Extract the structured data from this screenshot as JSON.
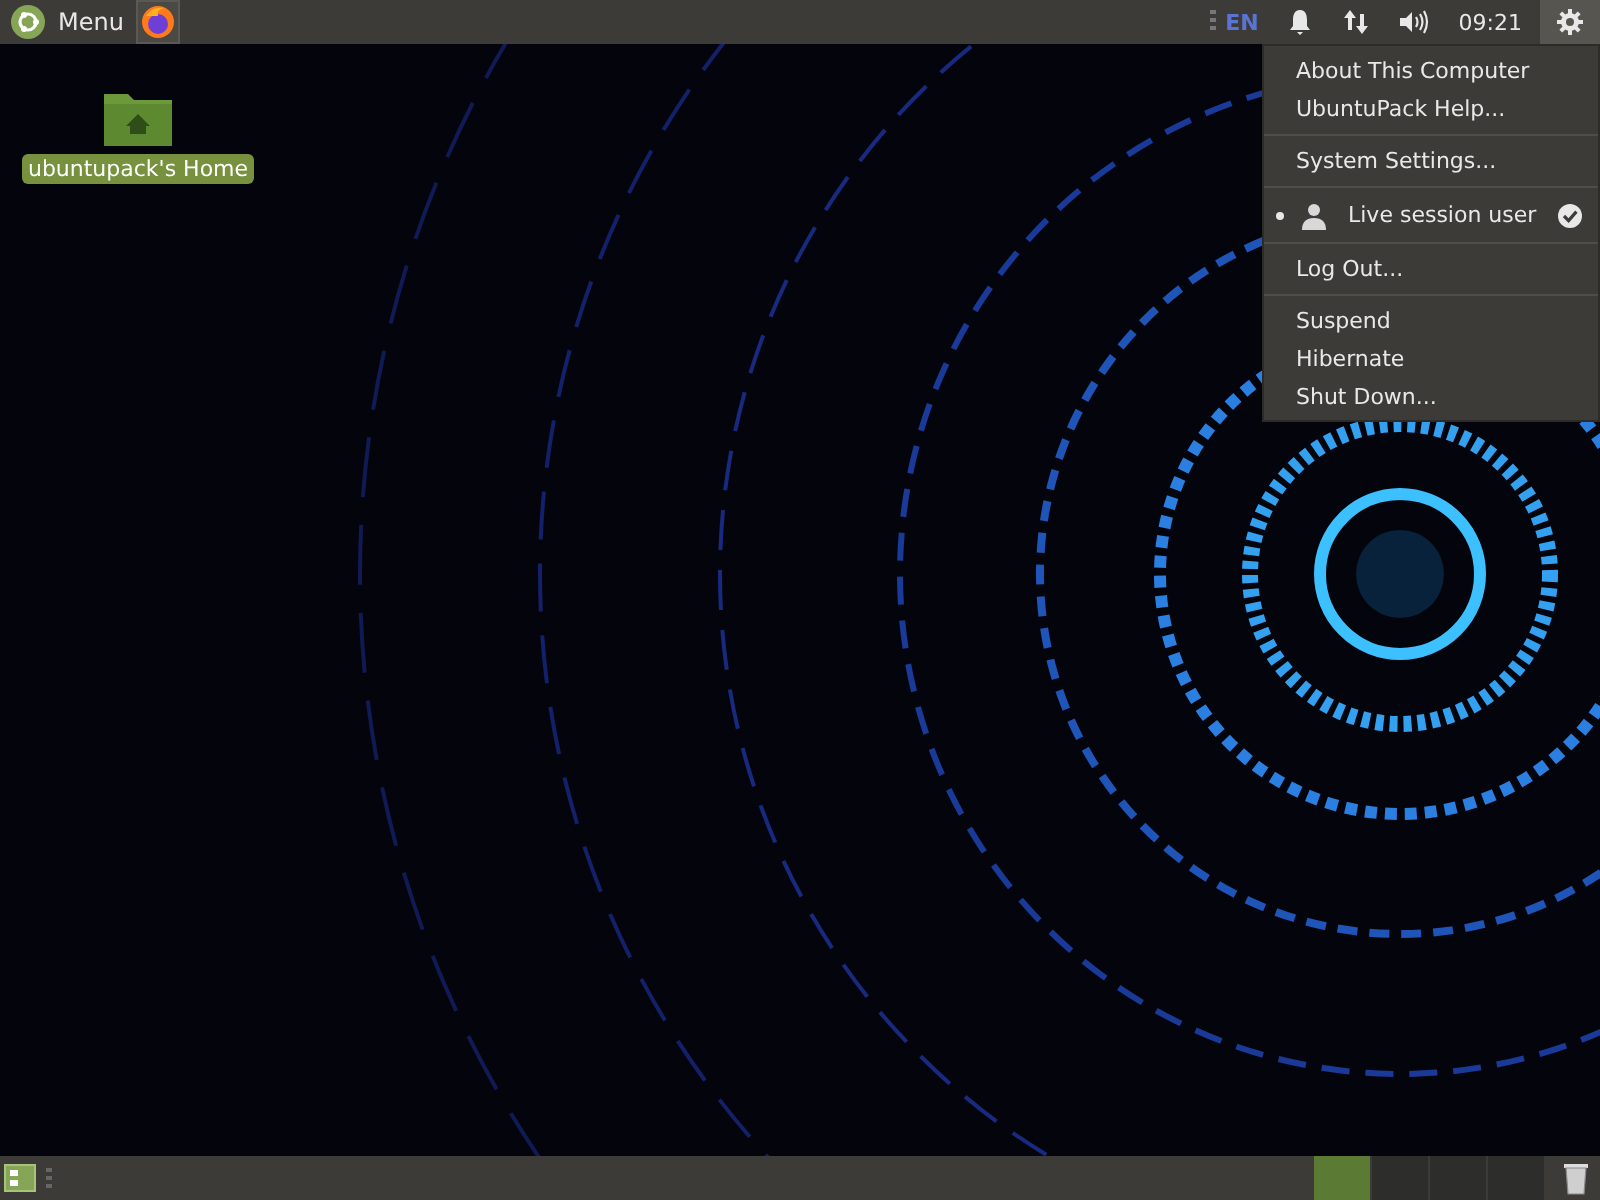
{
  "top_panel": {
    "menu_label": "Menu",
    "keyboard_layout": "EN",
    "clock": "09:21"
  },
  "desktop_icons": [
    {
      "label": "ubuntupack's Home"
    }
  ],
  "system_menu": {
    "items": [
      {
        "kind": "item",
        "label": "About This Computer"
      },
      {
        "kind": "item",
        "label": "UbuntuPack Help..."
      },
      {
        "kind": "separator"
      },
      {
        "kind": "item",
        "label": "System Settings..."
      },
      {
        "kind": "separator"
      },
      {
        "kind": "user",
        "label": "Live session user",
        "checked": true
      },
      {
        "kind": "separator"
      },
      {
        "kind": "item",
        "label": "Log Out..."
      },
      {
        "kind": "separator"
      },
      {
        "kind": "item",
        "label": "Suspend"
      },
      {
        "kind": "item",
        "label": "Hibernate"
      },
      {
        "kind": "item",
        "label": "Shut Down..."
      }
    ]
  },
  "workspaces": [
    {
      "selected": true
    },
    {
      "selected": false
    },
    {
      "selected": false
    },
    {
      "selected": false
    }
  ]
}
